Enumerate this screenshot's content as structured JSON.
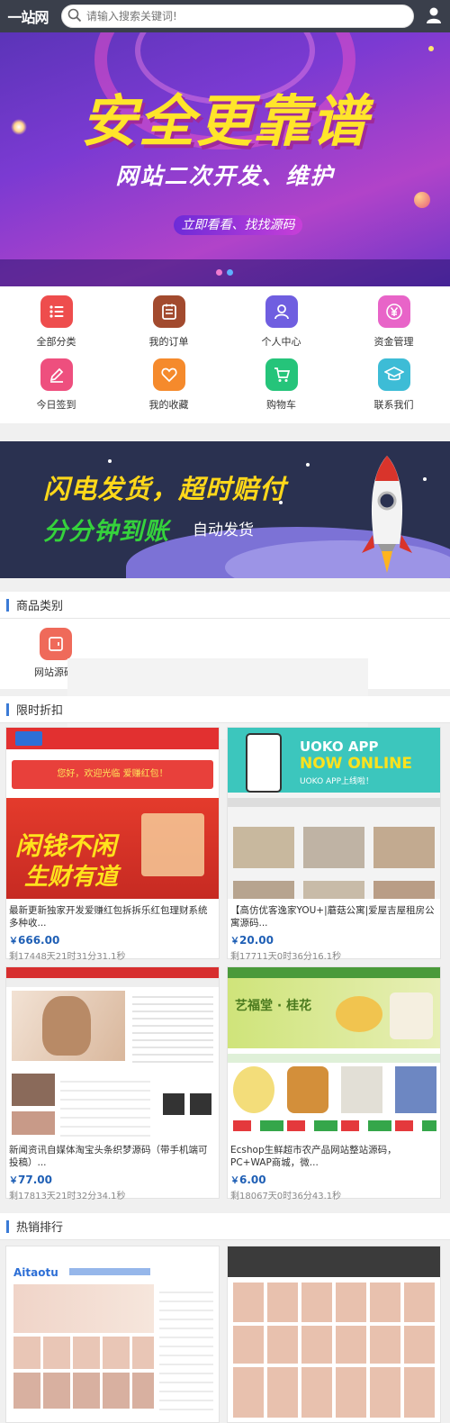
{
  "header": {
    "logo_text": "一站网",
    "search_placeholder": "请输入搜索关键词!"
  },
  "banner": {
    "headline": "安全更靠谱",
    "subtitle": "网站二次开发、维护",
    "cta": "立即看看、找找源码",
    "slides": 2,
    "active_slide": 2
  },
  "menu": [
    {
      "label": "全部分类",
      "icon": "list-icon",
      "color": "#ee4d4d"
    },
    {
      "label": "我的订单",
      "icon": "order-icon",
      "color": "#a24a2e"
    },
    {
      "label": "个人中心",
      "icon": "user-icon",
      "color": "#6f5ee0"
    },
    {
      "label": "资金管理",
      "icon": "yen-icon",
      "color": "#e864c8"
    },
    {
      "label": "今日签到",
      "icon": "pen-icon",
      "color": "#ee4f7e"
    },
    {
      "label": "我的收藏",
      "icon": "heart-icon",
      "color": "#f58a2c"
    },
    {
      "label": "购物车",
      "icon": "cart-icon",
      "color": "#25c47a"
    },
    {
      "label": "联系我们",
      "icon": "graduation-icon",
      "color": "#3dbcd6"
    }
  ],
  "promo": {
    "line1": "闪电发货，超时赔付",
    "line2": "分分钟到账",
    "line3": "自动发货"
  },
  "category_section": {
    "title": "商品类别",
    "items": [
      {
        "label": "网站源码",
        "icon": "folder-icon"
      }
    ]
  },
  "flash_section": {
    "title": "限时折扣",
    "products": [
      {
        "name": "最新更新独家开发爱赚红包拆拆乐红包理财系统多种收...",
        "price_symbol": "￥",
        "price": "666.00",
        "timer": "剩17448天21时31分31.1秒"
      },
      {
        "name": "【高仿优客逸家YOU+|蘑菇公寓|爱屋吉屋租房公寓源码...",
        "price_symbol": "￥",
        "price": "20.00",
        "timer": "剩17711天0时36分16.1秒"
      },
      {
        "name": "新闻资讯自媒体淘宝头条织梦源码（带手机端可投稿）...",
        "price_symbol": "￥",
        "price": "77.00",
        "timer": "剩17813天21时32分34.1秒"
      },
      {
        "name": "Ecshop生鲜超市农产品网站整站源码，PC+WAP商城，微...",
        "price_symbol": "￥",
        "price": "6.00",
        "timer": "剩18067天0时36分43.1秒"
      }
    ]
  },
  "hot_section": {
    "title": "热销排行"
  },
  "thumbnails": {
    "p1_text1": "您好，欢迎光临 爱赚红包！",
    "p1_text2": "闲钱不闲",
    "p1_text3": "生财有道",
    "p2_text1": "UOKO APP",
    "p2_text2": "NOW ONLINE",
    "p2_text3": "UOKO APP上线啦！",
    "p4_text1": "艺福堂 · 桂花",
    "h1_logo": "Aitaotu"
  }
}
